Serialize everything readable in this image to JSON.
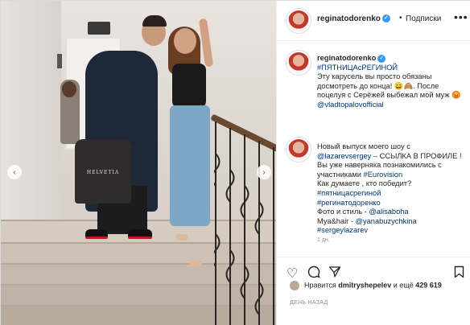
{
  "header": {
    "username": "reginatodorenko",
    "separator": "•",
    "follow_label": "Подписки",
    "more_icon": "more-horizontal-icon"
  },
  "photo": {
    "bag_text": "HELVETIA"
  },
  "caption": {
    "username": "reginatodorenko",
    "hashtag_top": "#ПЯТНИЦАсРЕГИНОЙ",
    "text1": "Эту карусель вы просто обязаны досмотреть до конца! 😄🙈. После поцелуя с Серёжей выбежал мой муж 😡",
    "mention1": "@vladtopalovofficial"
  },
  "comment2": {
    "text1": "Новый выпуск моего шоу с",
    "mention1": "@lazarevsergey",
    "text2": "– ССЫЛКА В ПРОФИЛЕ !",
    "text3": "Вы уже наверняка познакомились с участниками",
    "tag_eurovision": "#Eurovision",
    "text4": "Как думаете , кто победит?",
    "tag1": "#пятницасрегиной",
    "tag2": "#регинатодоренко",
    "text5": "Фото и стиль -",
    "mention2": "@alisaboha",
    "text6": "Муа&hair -",
    "mention3": "@yanabuzychkina",
    "tag3": "#sergeylazarev"
  },
  "time_comment": "1 дн.",
  "likes": {
    "prefix": "Нравится",
    "user": "dmitryshepelev",
    "middle": "и ещё",
    "count": "429 619"
  },
  "post_time": "ДЕНЬ НАЗАД"
}
